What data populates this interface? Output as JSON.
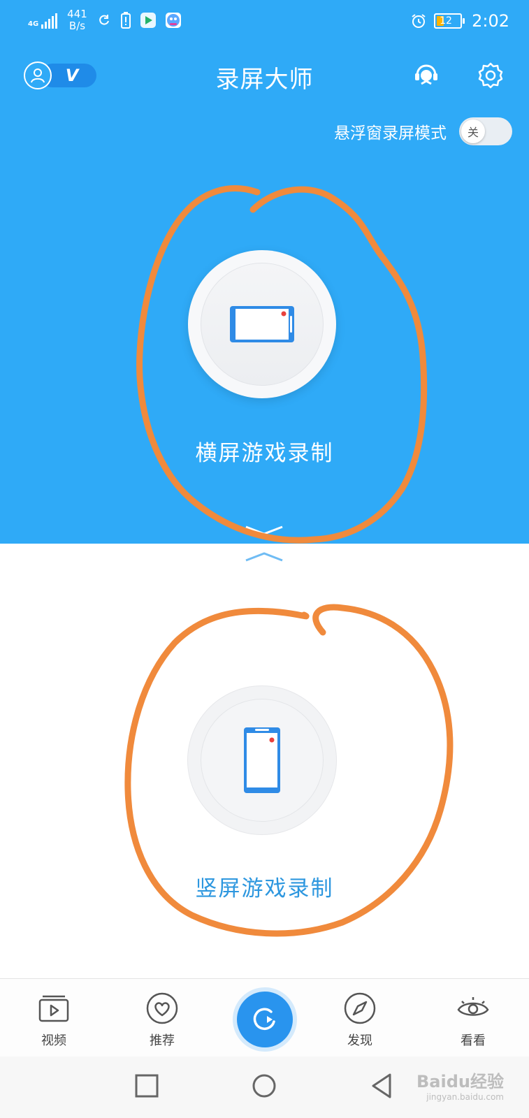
{
  "status_bar": {
    "network_type": "4G",
    "network_speed": "441",
    "network_speed_unit": "B/s",
    "battery_level": "12",
    "time": "2:02"
  },
  "header": {
    "title": "录屏大师",
    "vip_badge": "V"
  },
  "float_mode": {
    "label": "悬浮窗录屏模式",
    "toggle_state": "关"
  },
  "landscape": {
    "label": "横屏游戏录制"
  },
  "portrait": {
    "label": "竖屏游戏录制"
  },
  "bottom_nav": {
    "items": [
      {
        "label": "视频",
        "icon": "video-icon"
      },
      {
        "label": "推荐",
        "icon": "heart-icon"
      },
      {
        "label": "",
        "icon": "record-icon"
      },
      {
        "label": "发现",
        "icon": "compass-icon"
      },
      {
        "label": "看看",
        "icon": "eye-icon"
      }
    ]
  },
  "colors": {
    "primary_blue": "#2faaf7",
    "accent_blue": "#2994ee",
    "annotation_orange": "#f08a3c",
    "portrait_label": "#2d97df"
  },
  "watermark": {
    "text": "Baidu经验",
    "subtext": "jingyan.baidu.com"
  }
}
